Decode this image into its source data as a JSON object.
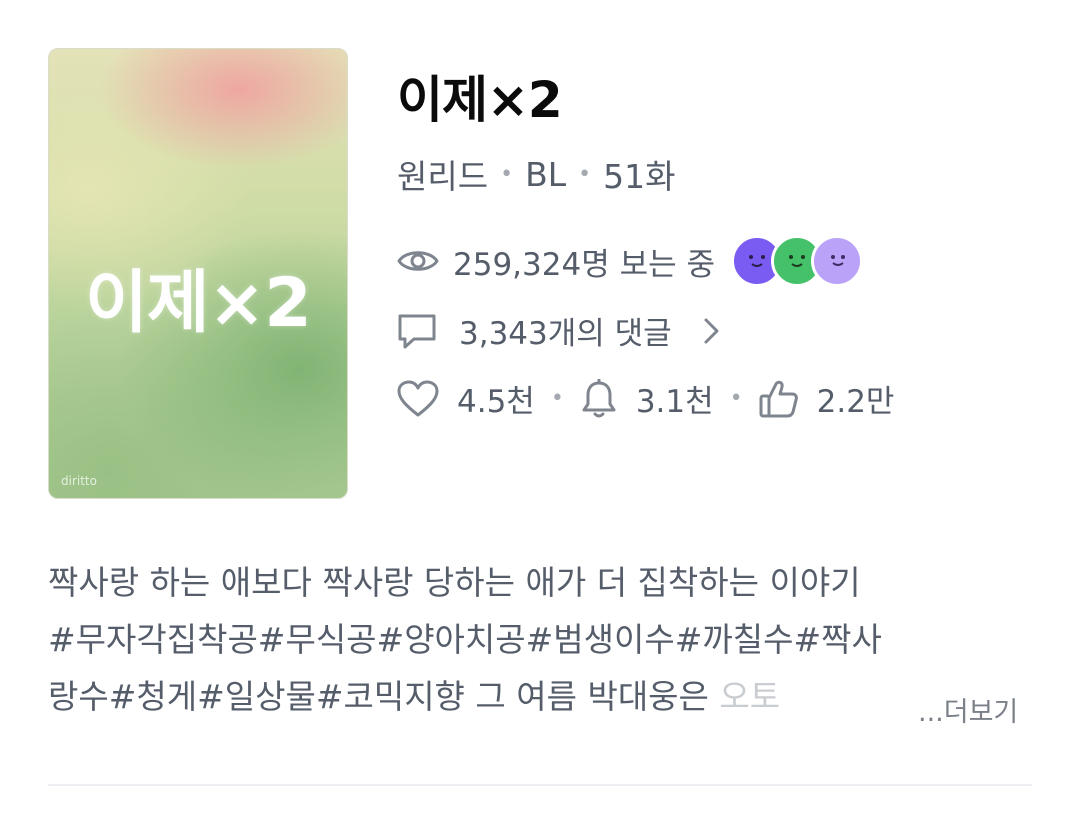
{
  "cover": {
    "title": "이제×2",
    "watermark": "diritto"
  },
  "work": {
    "title": "이제×2",
    "source": "원리드",
    "genre": "BL",
    "episodes": "51화",
    "viewers": "259,324명 보는 중",
    "comments": "3,343개의 댓글",
    "likes": "4.5천",
    "subscribers": "3.1천",
    "recommends": "2.2만"
  },
  "icons": {
    "views": "eye-icon",
    "comments": "comment-icon",
    "comments_arrow": "chevron-right-icon",
    "likes": "heart-icon",
    "subscribers": "bell-icon",
    "recommends": "thumbs-up-icon"
  },
  "avatar_colors": [
    "#7b5cf2",
    "#45c16a",
    "#b9a2f7"
  ],
  "description": {
    "line1": "짝사랑 하는 애보다 짝사랑 당하는 애가 더 집착하는 이야기",
    "line2": "#무자각집착공#무식공#양아치공#범생이수#까칠수#짝사",
    "line3": "랑수#청게#일상물#코믹지향 그 여름 박대웅은 ",
    "line3_faded": "오토",
    "more": "...더보기"
  }
}
